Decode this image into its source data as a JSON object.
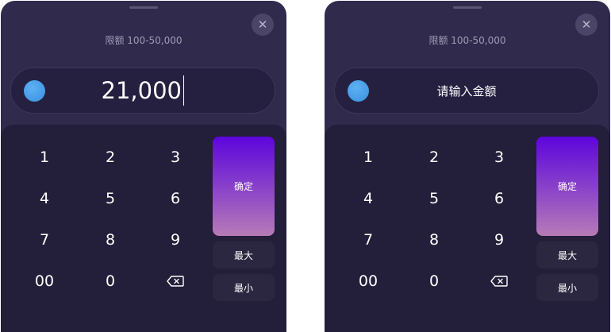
{
  "panels": [
    {
      "limit_text": "限额 100-50,000",
      "amount_value": "21,000",
      "keys": [
        "1",
        "2",
        "3",
        "4",
        "5",
        "6",
        "7",
        "8",
        "9",
        "00",
        "0"
      ],
      "confirm_label": "确定",
      "max_label": "最大",
      "min_label": "最小"
    },
    {
      "limit_text": "限额 100-50,000",
      "amount_placeholder": "请输入金额",
      "keys": [
        "1",
        "2",
        "3",
        "4",
        "5",
        "6",
        "7",
        "8",
        "9",
        "00",
        "0"
      ],
      "confirm_label": "确定",
      "max_label": "最大",
      "min_label": "最小"
    }
  ],
  "icons": {
    "close": "close-icon",
    "coin": "coin-icon",
    "backspace": "backspace-icon"
  },
  "colors": {
    "panel_bg": "#302a4d",
    "keypad_bg": "#231e39",
    "confirm_gradient_top": "#5e05dc",
    "confirm_gradient_bottom": "#b67bb7",
    "coin": "#3a8fe0"
  }
}
